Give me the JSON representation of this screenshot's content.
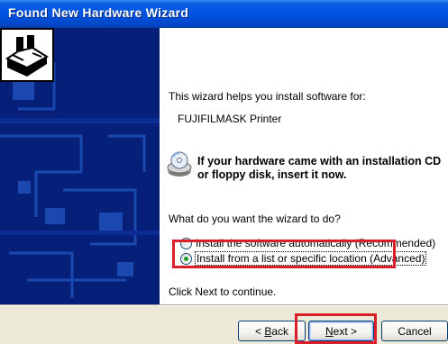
{
  "window": {
    "title": "Found New Hardware Wizard"
  },
  "wizard": {
    "intro": "This wizard helps you install software for:",
    "device": "FUJIFILMASK Printer",
    "cd_line1": "If your hardware came with an installation CD",
    "cd_line2": "or floppy disk, insert it now.",
    "question": "What do you want the wizard to do?",
    "options": [
      {
        "label": "Install the software automatically (Recommended)",
        "selected": false
      },
      {
        "label": "Install from a list or specific location (Advanced)",
        "selected": true
      }
    ],
    "next_hint": "Click Next to continue."
  },
  "buttons": {
    "back": {
      "label": "< Back",
      "accel": "B"
    },
    "next": {
      "label": "Next >",
      "accel": "N"
    },
    "cancel": {
      "label": "Cancel"
    }
  },
  "colors": {
    "highlight": "#d9202a",
    "sidebar": "#06207a",
    "titlebar": "#0054e3"
  },
  "icons": [
    "hardware-card-icon",
    "cd-disk-icon"
  ]
}
